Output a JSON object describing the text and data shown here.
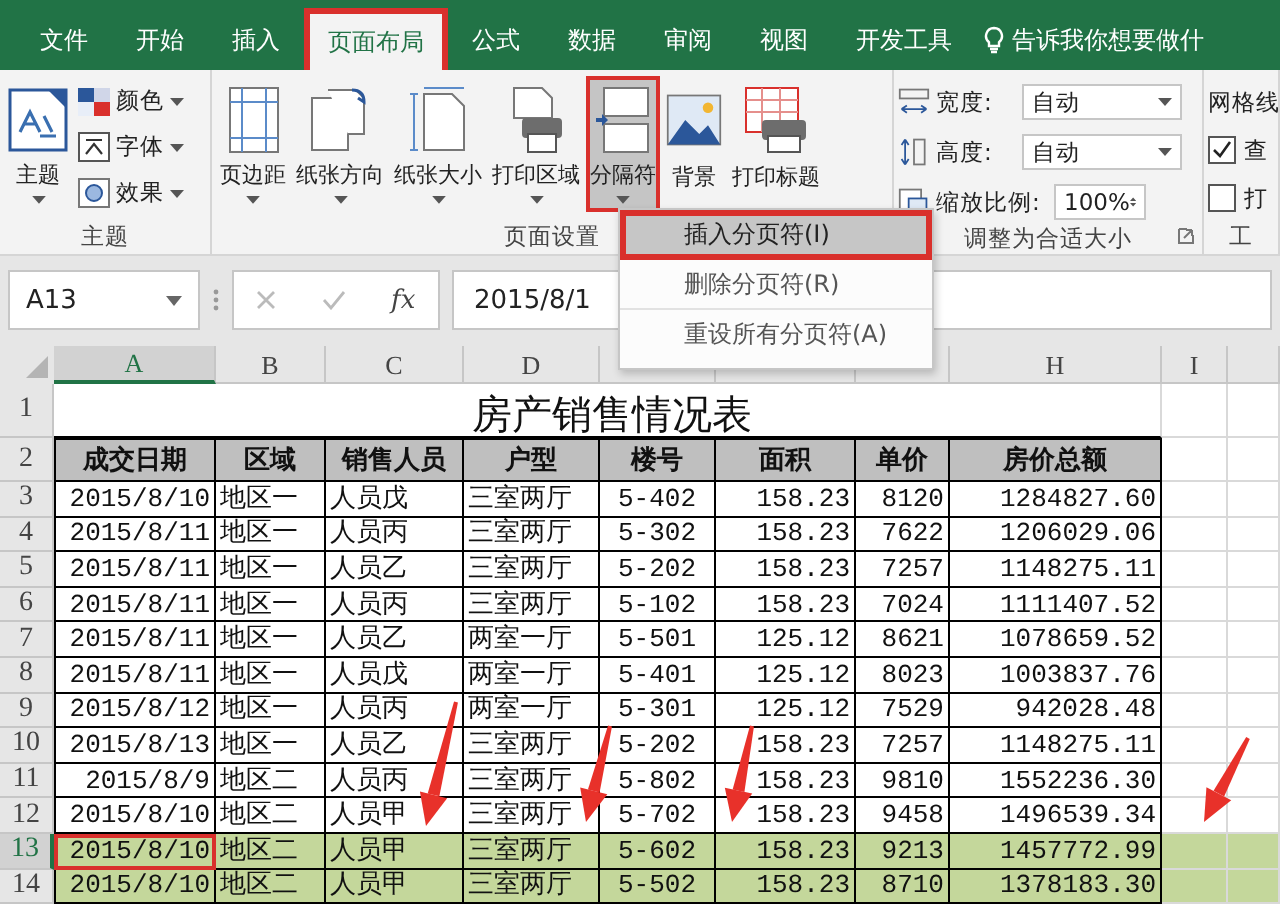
{
  "tabs": [
    {
      "label": "文件",
      "selected": false
    },
    {
      "label": "开始",
      "selected": false
    },
    {
      "label": "插入",
      "selected": false
    },
    {
      "label": "页面布局",
      "selected": true
    },
    {
      "label": "公式",
      "selected": false
    },
    {
      "label": "数据",
      "selected": false
    },
    {
      "label": "审阅",
      "selected": false
    },
    {
      "label": "视图",
      "selected": false
    },
    {
      "label": "开发工具",
      "selected": false
    }
  ],
  "tell_me": "告诉我你想要做什",
  "ribbon": [
    {
      "label": "主题",
      "launcher": false,
      "items": [
        {
          "kind": "large",
          "label": "主题",
          "dropdown": true,
          "selected": false
        },
        {
          "kind": "small",
          "label": "颜色",
          "dropdown": true
        },
        {
          "kind": "small",
          "label": "字体",
          "dropdown": true
        },
        {
          "kind": "small",
          "label": "效果",
          "dropdown": true
        }
      ]
    },
    {
      "label": "页面设置",
      "launcher": false,
      "items": [
        {
          "kind": "large",
          "label": "页边距",
          "dropdown": true,
          "selected": false
        },
        {
          "kind": "large",
          "label": "纸张方向",
          "dropdown": true,
          "selected": false
        },
        {
          "kind": "large",
          "label": "纸张大小",
          "dropdown": true,
          "selected": false
        },
        {
          "kind": "large",
          "label": "打印区域",
          "dropdown": true,
          "selected": false
        },
        {
          "kind": "large",
          "label": "分隔符",
          "dropdown": true,
          "selected": true
        },
        {
          "kind": "large",
          "label": "背景",
          "dropdown": false,
          "selected": false
        },
        {
          "kind": "large",
          "label": "打印标题",
          "dropdown": false,
          "selected": false
        }
      ]
    },
    {
      "label": "调整为合适大小",
      "launcher": true,
      "items": [
        {
          "kind": "field",
          "label": "宽度:",
          "value": "自动"
        },
        {
          "kind": "field",
          "label": "高度:",
          "value": "自动"
        },
        {
          "kind": "spinner",
          "label": "缩放比例:",
          "value": "100%"
        }
      ]
    },
    {
      "label": "工",
      "launcher": false,
      "items": [
        {
          "kind": "heading",
          "label": "网格线"
        },
        {
          "kind": "check",
          "label": "查",
          "checked": true
        },
        {
          "kind": "check",
          "label": "打",
          "checked": false
        }
      ]
    }
  ],
  "menu": [
    {
      "label": "插入分页符(I)",
      "selected": true
    },
    {
      "label": "删除分页符(R)",
      "selected": false
    },
    {
      "label": "重设所有分页符(A)",
      "selected": false
    }
  ],
  "formula_bar": {
    "name_box": "A13",
    "function_label": "fx",
    "value": "2015/8/1"
  },
  "sheet": {
    "columns": [
      {
        "label": "A",
        "selected": true
      },
      {
        "label": "B",
        "selected": false
      },
      {
        "label": "C",
        "selected": false
      },
      {
        "label": "D",
        "selected": false
      },
      {
        "selected": false
      },
      {
        "selected": false
      },
      {
        "selected": false
      },
      {
        "label": "H",
        "selected": false
      },
      {
        "label": "I",
        "selected": false
      }
    ],
    "rows": [
      {
        "number": "1",
        "kind": "title",
        "cells": [
          "",
          "",
          "",
          "房产销售情况表"
        ]
      },
      {
        "number": "2",
        "kind": "header",
        "cells": [
          "成交日期",
          "区域",
          "销售人员",
          "户型",
          "楼号",
          "面积",
          "单价",
          "房价总额"
        ]
      },
      {
        "number": "3",
        "kind": "data",
        "highlighted": false,
        "selected": false,
        "cells": [
          "2015/8/10",
          "地区一",
          "人员戊",
          "三室两厅",
          "5-402",
          "158.23",
          "8120",
          "1284827.60"
        ]
      },
      {
        "number": "4",
        "kind": "data",
        "highlighted": false,
        "selected": false,
        "cells": [
          "2015/8/11",
          "地区一",
          "人员丙",
          "三室两厅",
          "5-302",
          "158.23",
          "7622",
          "1206029.06"
        ]
      },
      {
        "number": "5",
        "kind": "data",
        "highlighted": false,
        "selected": false,
        "cells": [
          "2015/8/11",
          "地区一",
          "人员乙",
          "三室两厅",
          "5-202",
          "158.23",
          "7257",
          "1148275.11"
        ]
      },
      {
        "number": "6",
        "kind": "data",
        "highlighted": false,
        "selected": false,
        "cells": [
          "2015/8/11",
          "地区一",
          "人员丙",
          "三室两厅",
          "5-102",
          "158.23",
          "7024",
          "1111407.52"
        ]
      },
      {
        "number": "7",
        "kind": "data",
        "highlighted": false,
        "selected": false,
        "cells": [
          "2015/8/11",
          "地区一",
          "人员乙",
          "两室一厅",
          "5-501",
          "125.12",
          "8621",
          "1078659.52"
        ]
      },
      {
        "number": "8",
        "kind": "data",
        "highlighted": false,
        "selected": false,
        "cells": [
          "2015/8/11",
          "地区一",
          "人员戊",
          "两室一厅",
          "5-401",
          "125.12",
          "8023",
          "1003837.76"
        ]
      },
      {
        "number": "9",
        "kind": "data",
        "highlighted": false,
        "selected": false,
        "cells": [
          "2015/8/12",
          "地区一",
          "人员丙",
          "两室一厅",
          "5-301",
          "125.12",
          "7529",
          "942028.48"
        ]
      },
      {
        "number": "10",
        "kind": "data",
        "highlighted": false,
        "selected": false,
        "cells": [
          "2015/8/13",
          "地区一",
          "人员乙",
          "三室两厅",
          "5-202",
          "158.23",
          "7257",
          "1148275.11"
        ]
      },
      {
        "number": "11",
        "kind": "data",
        "highlighted": false,
        "selected": false,
        "cells": [
          "2015/8/9",
          "地区二",
          "人员丙",
          "三室两厅",
          "5-802",
          "158.23",
          "9810",
          "1552236.30"
        ]
      },
      {
        "number": "12",
        "kind": "data",
        "highlighted": false,
        "selected": false,
        "cells": [
          "2015/8/10",
          "地区二",
          "人员甲",
          "三室两厅",
          "5-702",
          "158.23",
          "9458",
          "1496539.34"
        ]
      },
      {
        "number": "13",
        "kind": "data",
        "highlighted": true,
        "selected": true,
        "cells": [
          "2015/8/10",
          "地区二",
          "人员甲",
          "三室两厅",
          "5-602",
          "158.23",
          "9213",
          "1457772.99"
        ]
      },
      {
        "number": "14",
        "kind": "data",
        "highlighted": true,
        "selected": false,
        "cells": [
          "2015/8/10",
          "地区二",
          "人员甲",
          "三室两厅",
          "5-502",
          "158.23",
          "8710",
          "1378183.30"
        ]
      }
    ]
  }
}
